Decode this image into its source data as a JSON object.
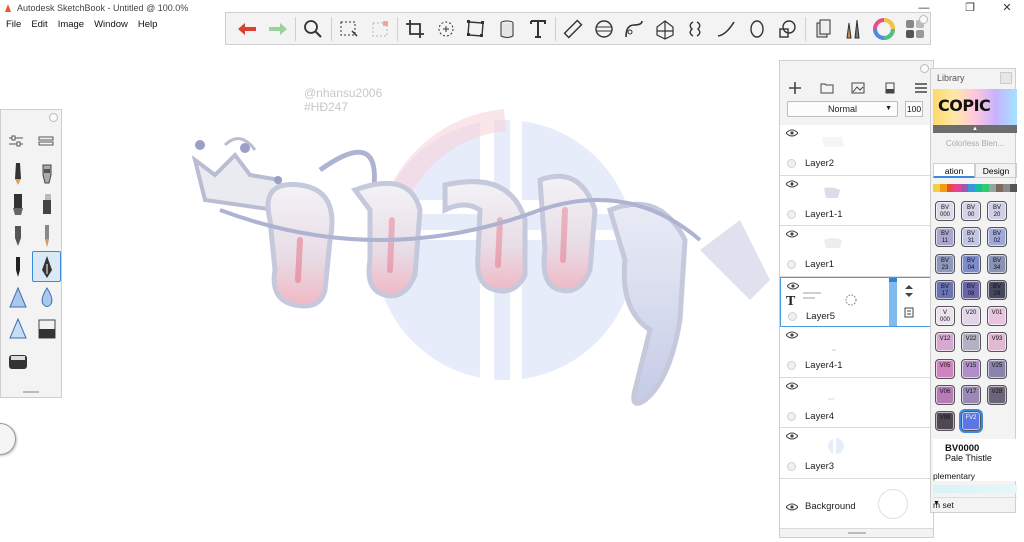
{
  "window": {
    "title": "Autodesk SketchBook - Untitled @ 100.0%",
    "minimize": "—",
    "maximize": "❐",
    "close": "✕"
  },
  "menu": [
    "File",
    "Edit",
    "Image",
    "Window",
    "Help"
  ],
  "toolbar": {
    "tools": [
      "undo-icon",
      "redo-icon",
      "zoom-icon",
      "select-icon",
      "transform-icon",
      "crop-icon",
      "lasso-fill-icon",
      "distort-icon",
      "fill-icon",
      "text-icon",
      "ruler-icon",
      "ellipse-guide-icon",
      "french-curve-icon",
      "perspective-icon",
      "symmetry-icon",
      "stroke-icon",
      "circle-icon",
      "shape-icon",
      "copic-library-icon",
      "brush-library-icon",
      "color-wheel-icon",
      "palette-icon"
    ]
  },
  "canvas": {
    "watermark_line1": "@nhansu2006",
    "watermark_line2": "#HĐ247"
  },
  "layers_panel": {
    "blend_mode": "Normal",
    "opacity": "100",
    "layers": [
      {
        "name": "Layer2",
        "visible": true,
        "selected": false
      },
      {
        "name": "Layer1-1",
        "visible": true,
        "selected": false
      },
      {
        "name": "Layer1",
        "visible": true,
        "selected": false
      },
      {
        "name": "Layer5",
        "visible": true,
        "selected": true,
        "type": "text"
      },
      {
        "name": "Layer4-1",
        "visible": true,
        "selected": false
      },
      {
        "name": "Layer4",
        "visible": true,
        "selected": false
      },
      {
        "name": "Layer3",
        "visible": true,
        "selected": false
      }
    ],
    "background": {
      "name": "Background"
    }
  },
  "copic_library": {
    "title": "Library",
    "logo": "COPIC",
    "colorless_blender": "Colorless Blen...",
    "tabs": [
      "ation",
      "Design"
    ],
    "active_tab": 0,
    "swatches": [
      {
        "code": "BV\n000",
        "color": "#dcd9ea"
      },
      {
        "code": "BV\n00",
        "color": "#d6d3e8"
      },
      {
        "code": "BV\n20",
        "color": "#cdd0e8"
      },
      {
        "code": "BV\n11",
        "color": "#a9a8cc"
      },
      {
        "code": "BV\n31",
        "color": "#c4c7e4"
      },
      {
        "code": "BV\n02",
        "color": "#9fa8d9"
      },
      {
        "code": "BV\n23",
        "color": "#8e98bd"
      },
      {
        "code": "BV\n04",
        "color": "#7f8ccc"
      },
      {
        "code": "BV\n34",
        "color": "#8a93b4"
      },
      {
        "code": "BV\n17",
        "color": "#6b74b3"
      },
      {
        "code": "BV\n08",
        "color": "#6866a9"
      },
      {
        "code": "BV\n29",
        "color": "#45475e"
      },
      {
        "code": "V\n000",
        "color": "#ece2ee"
      },
      {
        "code": "V20",
        "color": "#e1d5ea"
      },
      {
        "code": "V01",
        "color": "#e8c4de"
      },
      {
        "code": "V12",
        "color": "#d6a8d3"
      },
      {
        "code": "V22",
        "color": "#b5b1c4"
      },
      {
        "code": "V93",
        "color": "#e2b8d2"
      },
      {
        "code": "V05",
        "color": "#cf83bf"
      },
      {
        "code": "V15",
        "color": "#b28ec8"
      },
      {
        "code": "V25",
        "color": "#8b83ab"
      },
      {
        "code": "V06",
        "color": "#b67bb9"
      },
      {
        "code": "V17",
        "color": "#9a88b6"
      },
      {
        "code": "V28",
        "color": "#6b6579"
      },
      {
        "code": "V99",
        "color": "#4e4754"
      },
      {
        "code": "FV2",
        "color": "#5b77e6"
      }
    ],
    "selected_code": "BV0000",
    "selected_name": "Pale Thistle",
    "complementary_label": "plementary",
    "set_label": "m set"
  }
}
